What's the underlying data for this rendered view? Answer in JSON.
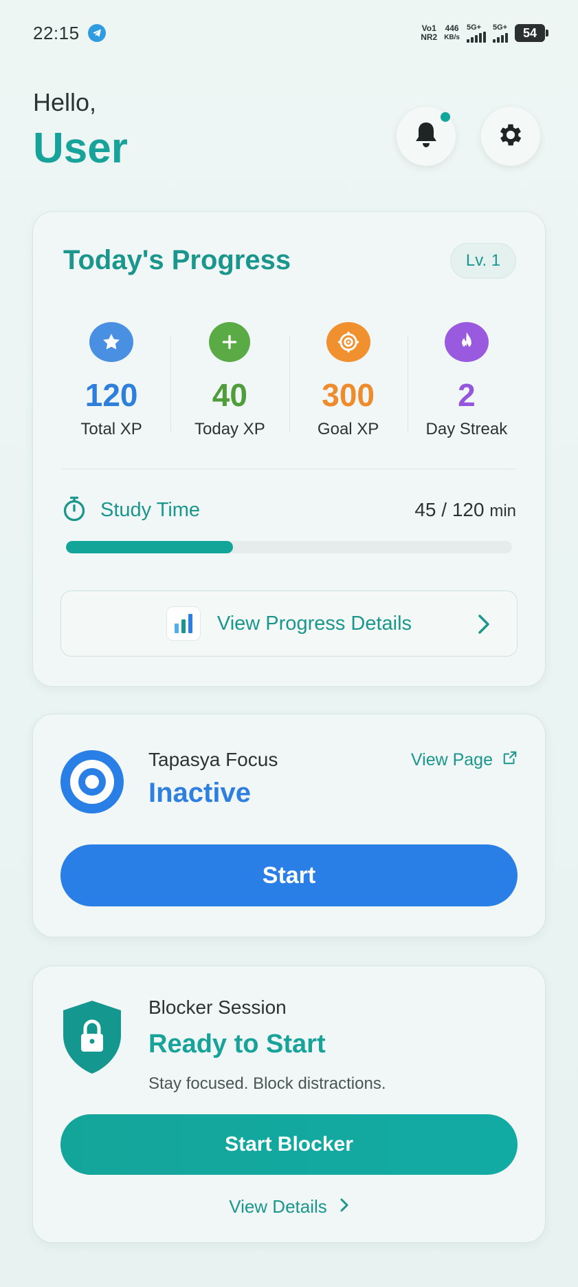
{
  "status_bar": {
    "time": "22:15",
    "volte_top": "Vo1",
    "volte_bottom": "NR2",
    "speed_value": "446",
    "speed_unit": "KB/s",
    "network1": "5G+",
    "network2": "5G+",
    "battery": "54"
  },
  "header": {
    "greeting": "Hello,",
    "username": "User"
  },
  "progress": {
    "title": "Today's Progress",
    "level": "Lv. 1",
    "stats": [
      {
        "value": "120",
        "label": "Total XP",
        "icon": "star-icon",
        "color": "#4a90e2"
      },
      {
        "value": "40",
        "label": "Today XP",
        "icon": "plus-icon",
        "color": "#5aaa45"
      },
      {
        "value": "300",
        "label": "Goal XP",
        "icon": "target-icon",
        "color": "#f0902f"
      },
      {
        "value": "2",
        "label": "Day Streak",
        "icon": "flame-icon",
        "color": "#9a5ae0"
      }
    ],
    "study_label": "Study Time",
    "study_current": "45",
    "study_separator": " / ",
    "study_goal": "120",
    "study_unit": "min",
    "study_fraction": 0.375,
    "details_label": "View Progress Details"
  },
  "focus": {
    "subtitle": "Tapasya Focus",
    "status": "Inactive",
    "view_page": "View Page",
    "start_label": "Start"
  },
  "blocker": {
    "subtitle": "Blocker Session",
    "status": "Ready to Start",
    "description": "Stay focused. Block distractions.",
    "start_label": "Start Blocker",
    "details_label": "View Details"
  },
  "colors": {
    "accent": "#17a39a",
    "blue": "#2a7fe6"
  }
}
